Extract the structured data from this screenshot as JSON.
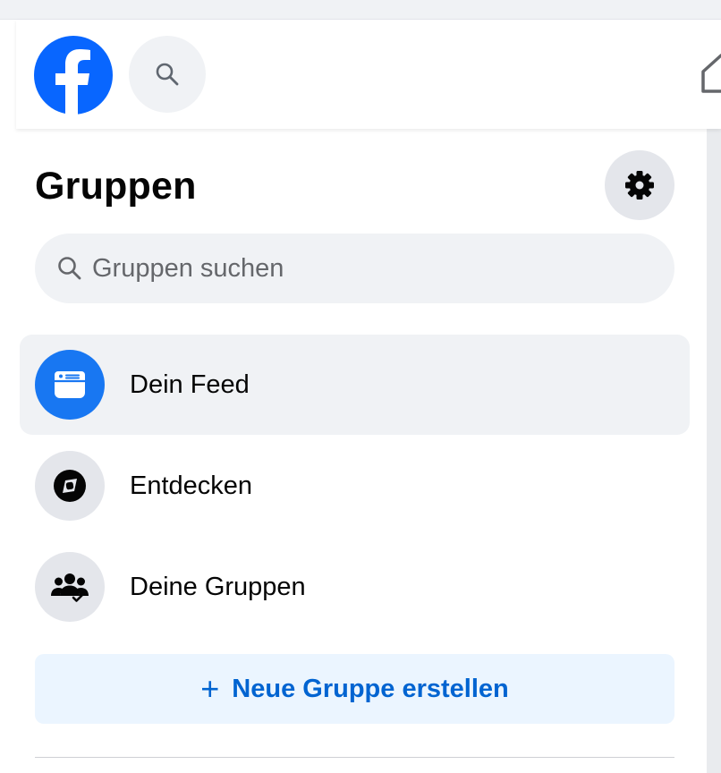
{
  "header": {
    "logo_icon": "facebook-logo",
    "search_icon": "search-icon",
    "home_icon": "home-icon"
  },
  "sidebar": {
    "title": "Gruppen",
    "settings_icon": "gear-icon",
    "search": {
      "placeholder": "Gruppen suchen",
      "value": ""
    },
    "nav_items": [
      {
        "label": "Dein Feed",
        "icon": "feed-icon",
        "active": true
      },
      {
        "label": "Entdecken",
        "icon": "compass-icon",
        "active": false
      },
      {
        "label": "Deine Gruppen",
        "icon": "groups-icon",
        "active": false
      }
    ],
    "create_button": {
      "plus": "+",
      "label": "Neue Gruppe erstellen"
    }
  },
  "colors": {
    "brand_blue": "#0866ff",
    "accent_blue": "#1877f2",
    "create_text": "#0064d1",
    "create_bg": "#ebf5ff",
    "active_bg": "#f0f2f5"
  }
}
